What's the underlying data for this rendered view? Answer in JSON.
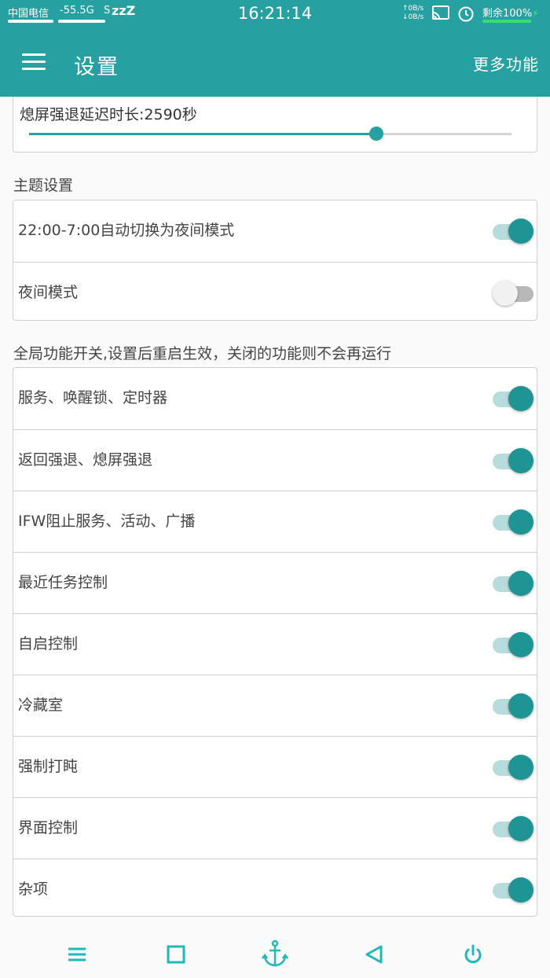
{
  "status_bar": {
    "carrier": "中国电信",
    "signal": "-55.5G",
    "extra": "S",
    "sleep": "zzZ",
    "time": "16:21:14",
    "speed_up": "0B/s",
    "speed_down": "0B/s",
    "battery": "剩余100%",
    "icons": [
      "cast-icon",
      "alarm-icon",
      "charging-icon"
    ]
  },
  "app_bar": {
    "title": "设置",
    "more_label": "更多功能"
  },
  "slider": {
    "label": "熄屏强退延迟时长:2590秒",
    "fraction": 0.72
  },
  "theme_section": {
    "title": "主题设置",
    "items": [
      {
        "label": "22:00-7:00自动切换为夜间模式",
        "on": true
      },
      {
        "label": "夜间模式",
        "on": false
      }
    ]
  },
  "global_section": {
    "title": "全局功能开关,设置后重启生效，关闭的功能则不会再运行",
    "items": [
      {
        "label": "服务、唤醒锁、定时器",
        "on": true
      },
      {
        "label": "返回强退、熄屏强退",
        "on": true
      },
      {
        "label": "IFW阻止服务、活动、广播",
        "on": true
      },
      {
        "label": "最近任务控制",
        "on": true
      },
      {
        "label": "自启控制",
        "on": true
      },
      {
        "label": "冷藏室",
        "on": true
      },
      {
        "label": "强制打盹",
        "on": true
      },
      {
        "label": "界面控制",
        "on": true
      },
      {
        "label": "杂项",
        "on": true
      }
    ]
  },
  "bottom_nav": [
    "menu-icon",
    "square-icon",
    "anchor-icon",
    "back-triangle-icon",
    "power-icon"
  ],
  "colors": {
    "primary": "#26a0a0",
    "switch_on_thumb": "#1f9494",
    "switch_on_track": "#b7dcdc",
    "nav_icon": "#20b8b8"
  }
}
